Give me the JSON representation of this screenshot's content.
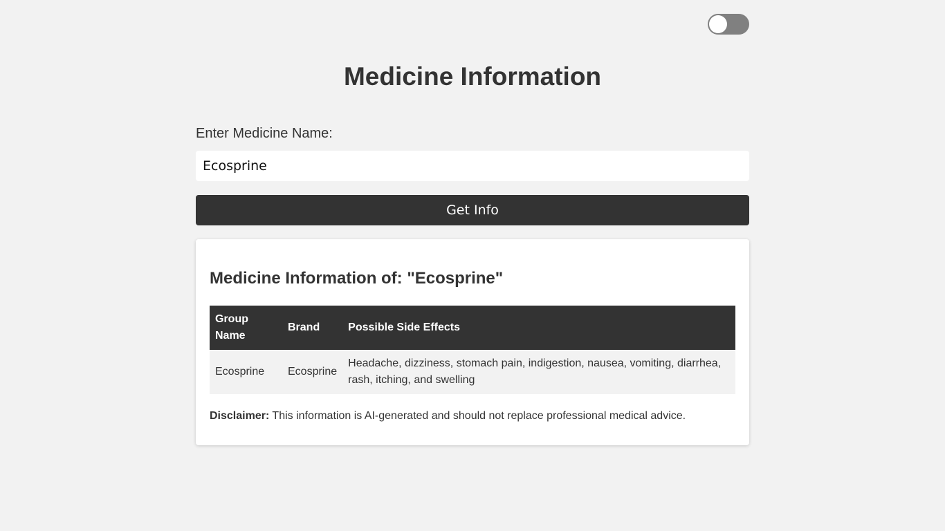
{
  "theme_toggle": {
    "state": "off",
    "colors": {
      "track": "#808080",
      "knob": "#ffffff"
    }
  },
  "page": {
    "title": "Medicine Information"
  },
  "form": {
    "label": "Enter Medicine Name:",
    "input_value": "Ecosprine",
    "button_label": "Get Info"
  },
  "result": {
    "heading": "Medicine Information of: \"Ecosprine\"",
    "table": {
      "headers": [
        "Group Name",
        "Brand",
        "Possible Side Effects"
      ],
      "rows": [
        [
          "Ecosprine",
          "Ecosprine",
          "Headache, dizziness, stomach pain, indigestion, nausea, vomiting, diarrhea, rash, itching, and swelling"
        ]
      ]
    },
    "disclaimer_label": "Disclaimer:",
    "disclaimer_text": " This information is AI-generated and should not replace professional medical advice."
  },
  "colors": {
    "background": "#f2f2f2",
    "primary": "#333333",
    "surface": "#ffffff"
  }
}
